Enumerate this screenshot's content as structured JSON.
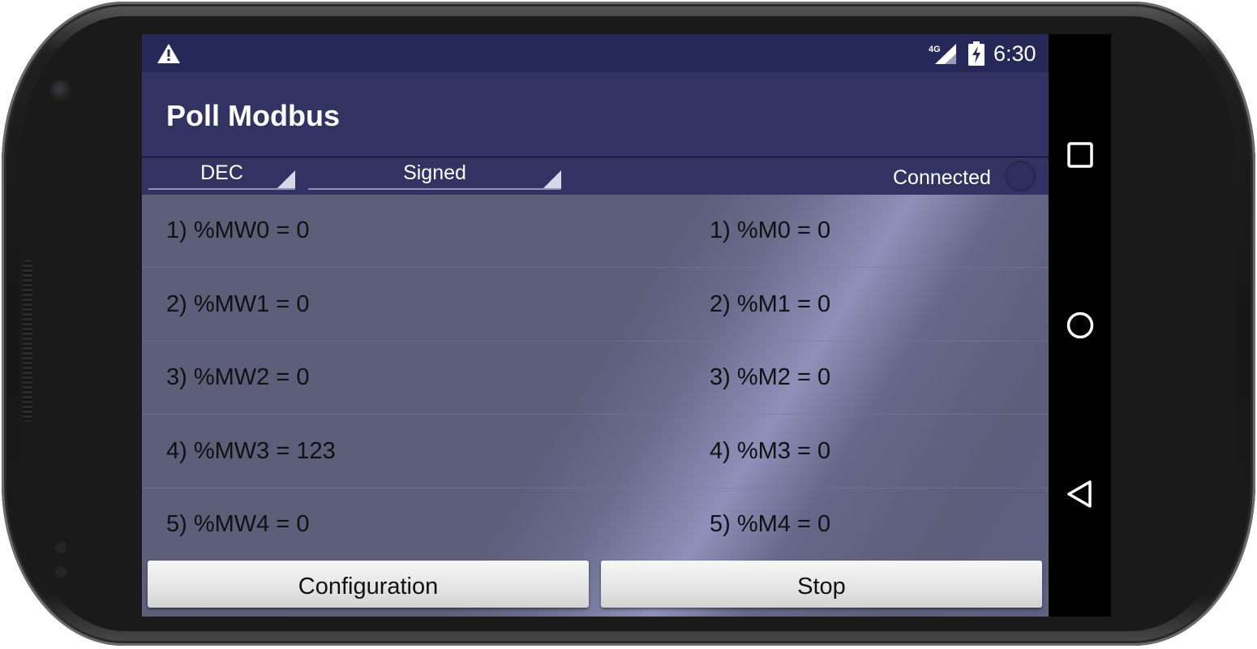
{
  "status_bar": {
    "network_type": "4G",
    "time": "6:30",
    "icons": [
      "warning-icon",
      "signal-icon",
      "battery-charging-icon"
    ]
  },
  "app_bar": {
    "title": "Poll Modbus"
  },
  "controls": {
    "radix_selected": "DEC",
    "sign_selected": "Signed",
    "connection_status": "Connected"
  },
  "registers": {
    "words": [
      "1) %MW0 = 0",
      "2) %MW1 = 0",
      "3) %MW2 = 0",
      "4) %MW3 = 123",
      "5) %MW4 = 0"
    ],
    "bits": [
      "1) %M0 = 0",
      "2) %M1 = 0",
      "3) %M2 = 0",
      "4) %M3 = 0",
      "5) %M4 = 0"
    ]
  },
  "buttons": {
    "configuration": "Configuration",
    "stop": "Stop"
  },
  "nav_bar": {
    "icons": [
      "recents-icon",
      "home-icon",
      "back-icon"
    ]
  }
}
